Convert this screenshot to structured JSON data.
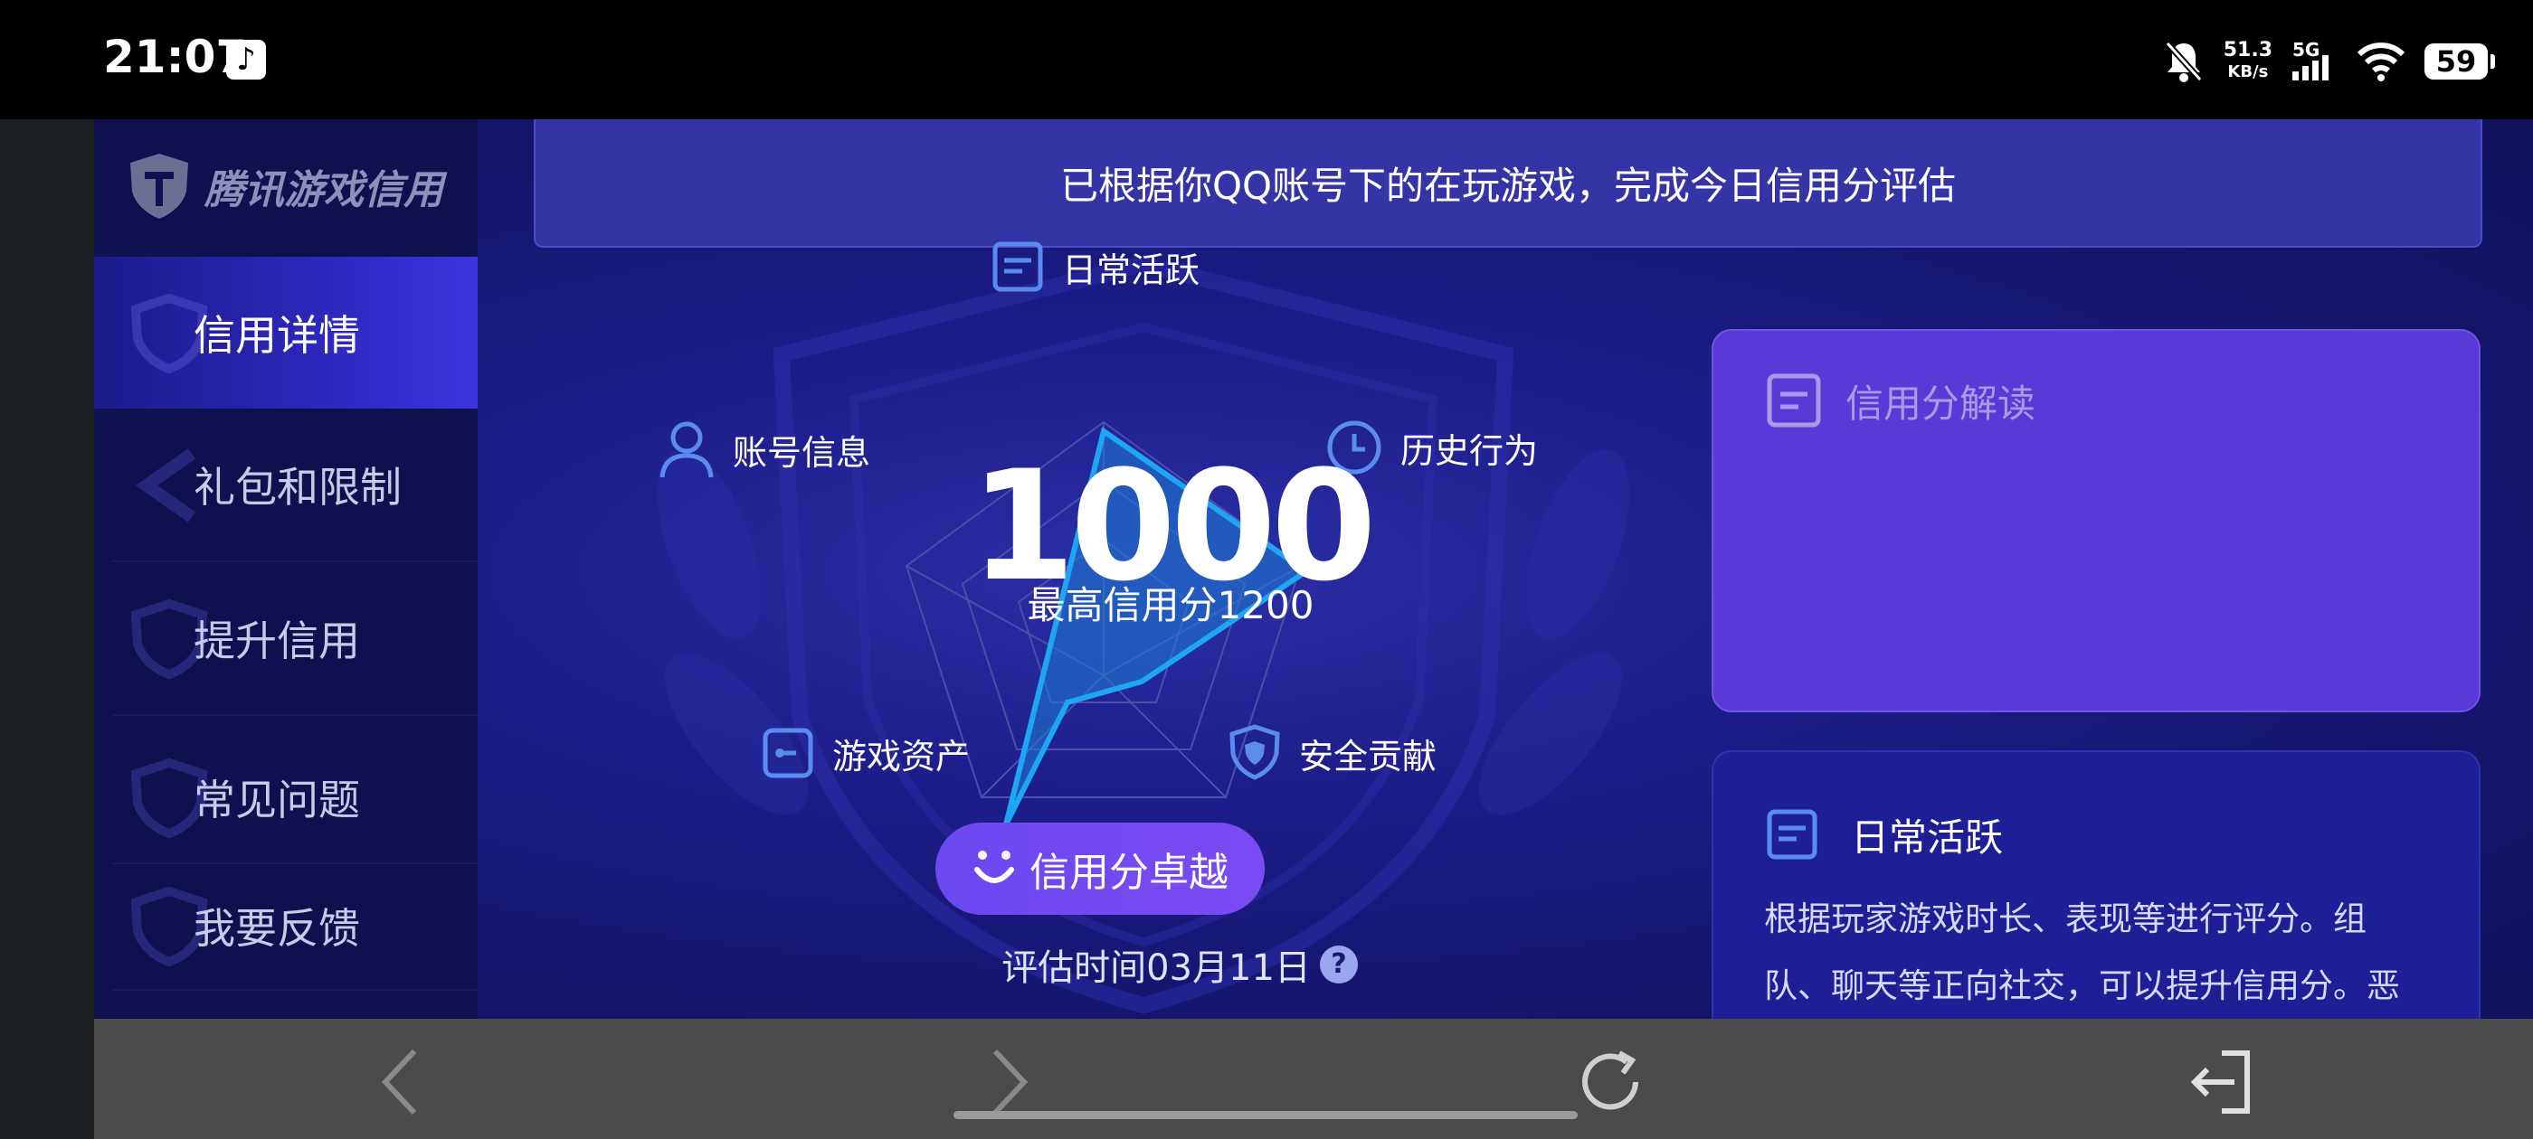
{
  "status_bar": {
    "time": "21:07",
    "app_icon": "tiktok-icon",
    "net_speed_value": "51.3",
    "net_speed_unit": "KB/s",
    "network": "5G",
    "battery": "59"
  },
  "sidebar": {
    "logo_text": "腾讯游戏信用",
    "items": [
      {
        "label": "信用详情",
        "active": true
      },
      {
        "label": "礼包和限制",
        "active": false
      },
      {
        "label": "提升信用",
        "active": false
      },
      {
        "label": "常见问题",
        "active": false
      },
      {
        "label": "我要反馈",
        "active": false
      }
    ]
  },
  "banner": {
    "text": "已根据你QQ账号下的在玩游戏，完成今日信用分评估"
  },
  "radar": {
    "axes": [
      {
        "label": "日常活跃",
        "icon": "document-icon"
      },
      {
        "label": "历史行为",
        "icon": "clock-icon"
      },
      {
        "label": "安全贡献",
        "icon": "shield-icon"
      },
      {
        "label": "游戏资产",
        "icon": "key-box-icon"
      },
      {
        "label": "账号信息",
        "icon": "user-icon"
      }
    ],
    "score": "1000",
    "max_text": "最高信用分1200",
    "badge_label": "信用分卓越",
    "eval_text": "评估时间03月11日",
    "help_glyph": "?"
  },
  "cards": {
    "interpret": {
      "title": "信用分解读"
    },
    "daily": {
      "title": "日常活跃",
      "line1": "根据玩家游戏时长、表现等进行评分。组",
      "line2": "队、聊天等正向社交，可以提升信用分。恶"
    }
  },
  "colors": {
    "background": "#16166e",
    "sidebar": "#10104e",
    "accent_purple": "#6b48ef",
    "radar_fill": "#1e88e5"
  }
}
